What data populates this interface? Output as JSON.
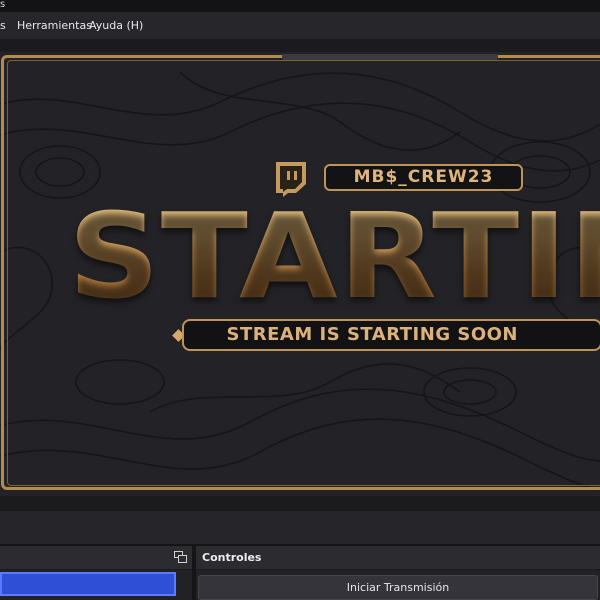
{
  "window": {
    "title_glyph": "s"
  },
  "menubar": {
    "items": [
      {
        "label": "s"
      },
      {
        "label": "Herramientas"
      },
      {
        "label": "Ayuda (H)"
      }
    ]
  },
  "preview": {
    "channel_name": "MB$_CREW23",
    "headline": "STARTING",
    "banner_text": "STREAM IS STARTING SOON",
    "logo": "twitch-icon",
    "colors": {
      "gold": "#c49a5f",
      "background": "#232327"
    }
  },
  "docks": {
    "controls": {
      "title": "Controles",
      "start_stream_label": "Iniciar Transmisión"
    }
  }
}
